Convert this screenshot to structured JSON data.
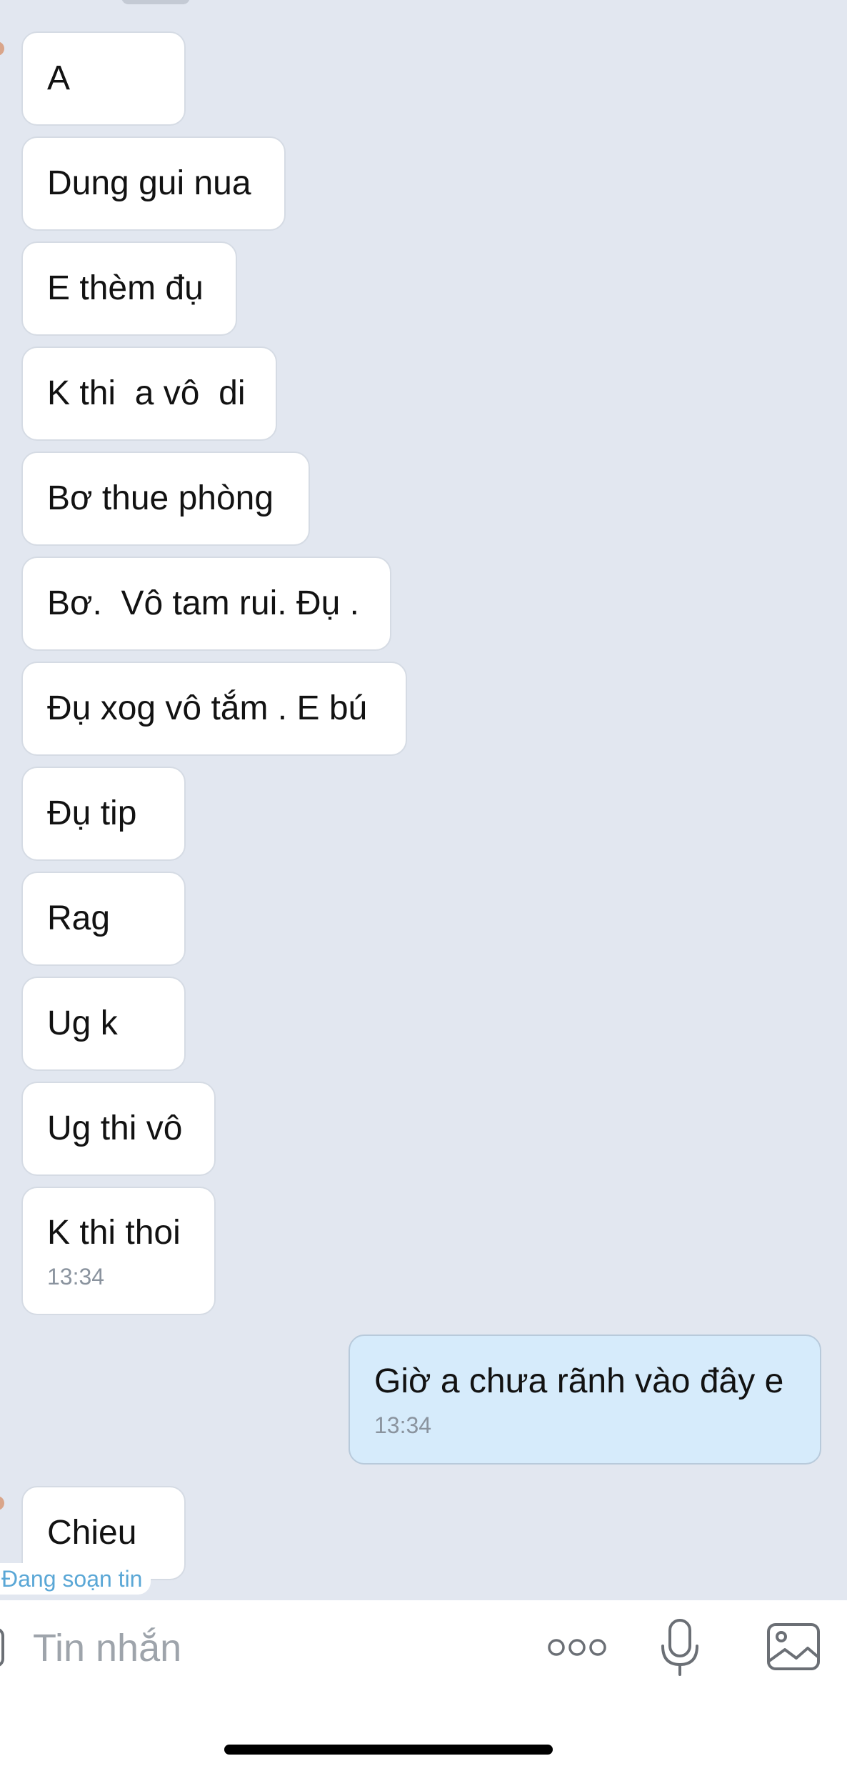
{
  "messages": [
    {
      "direction": "incoming",
      "text": "A"
    },
    {
      "direction": "incoming",
      "text": "Dung gui nua"
    },
    {
      "direction": "incoming",
      "text": "E thèm đụ"
    },
    {
      "direction": "incoming",
      "text": "K thi  a vô  di"
    },
    {
      "direction": "incoming",
      "text": "Bơ thue phòng"
    },
    {
      "direction": "incoming",
      "text": "Bơ.  Vô tam rui. Đụ ."
    },
    {
      "direction": "incoming",
      "text": "Đụ xog vô tắm . E bú"
    },
    {
      "direction": "incoming",
      "text": "Đụ tip"
    },
    {
      "direction": "incoming",
      "text": "Rag"
    },
    {
      "direction": "incoming",
      "text": "Ug k"
    },
    {
      "direction": "incoming",
      "text": "Ug thi vô"
    },
    {
      "direction": "incoming",
      "text": "K thi thoi",
      "time": "13:34"
    },
    {
      "direction": "outgoing",
      "text": "Giờ a chưa rãnh vào đây e",
      "time": "13:34"
    },
    {
      "direction": "incoming",
      "text": "Chieu"
    }
  ],
  "typing_indicator": "Đang soạn tin",
  "composer": {
    "placeholder": "Tin nhắn",
    "value": ""
  },
  "icons": {
    "more": "more-dots-icon",
    "mic": "microphone-icon",
    "image": "image-gallery-icon"
  },
  "colors": {
    "background": "#e2e7f0",
    "incoming_bubble": "#ffffff",
    "outgoing_bubble": "#d6ebfb",
    "typing_text": "#5aa7d6"
  }
}
